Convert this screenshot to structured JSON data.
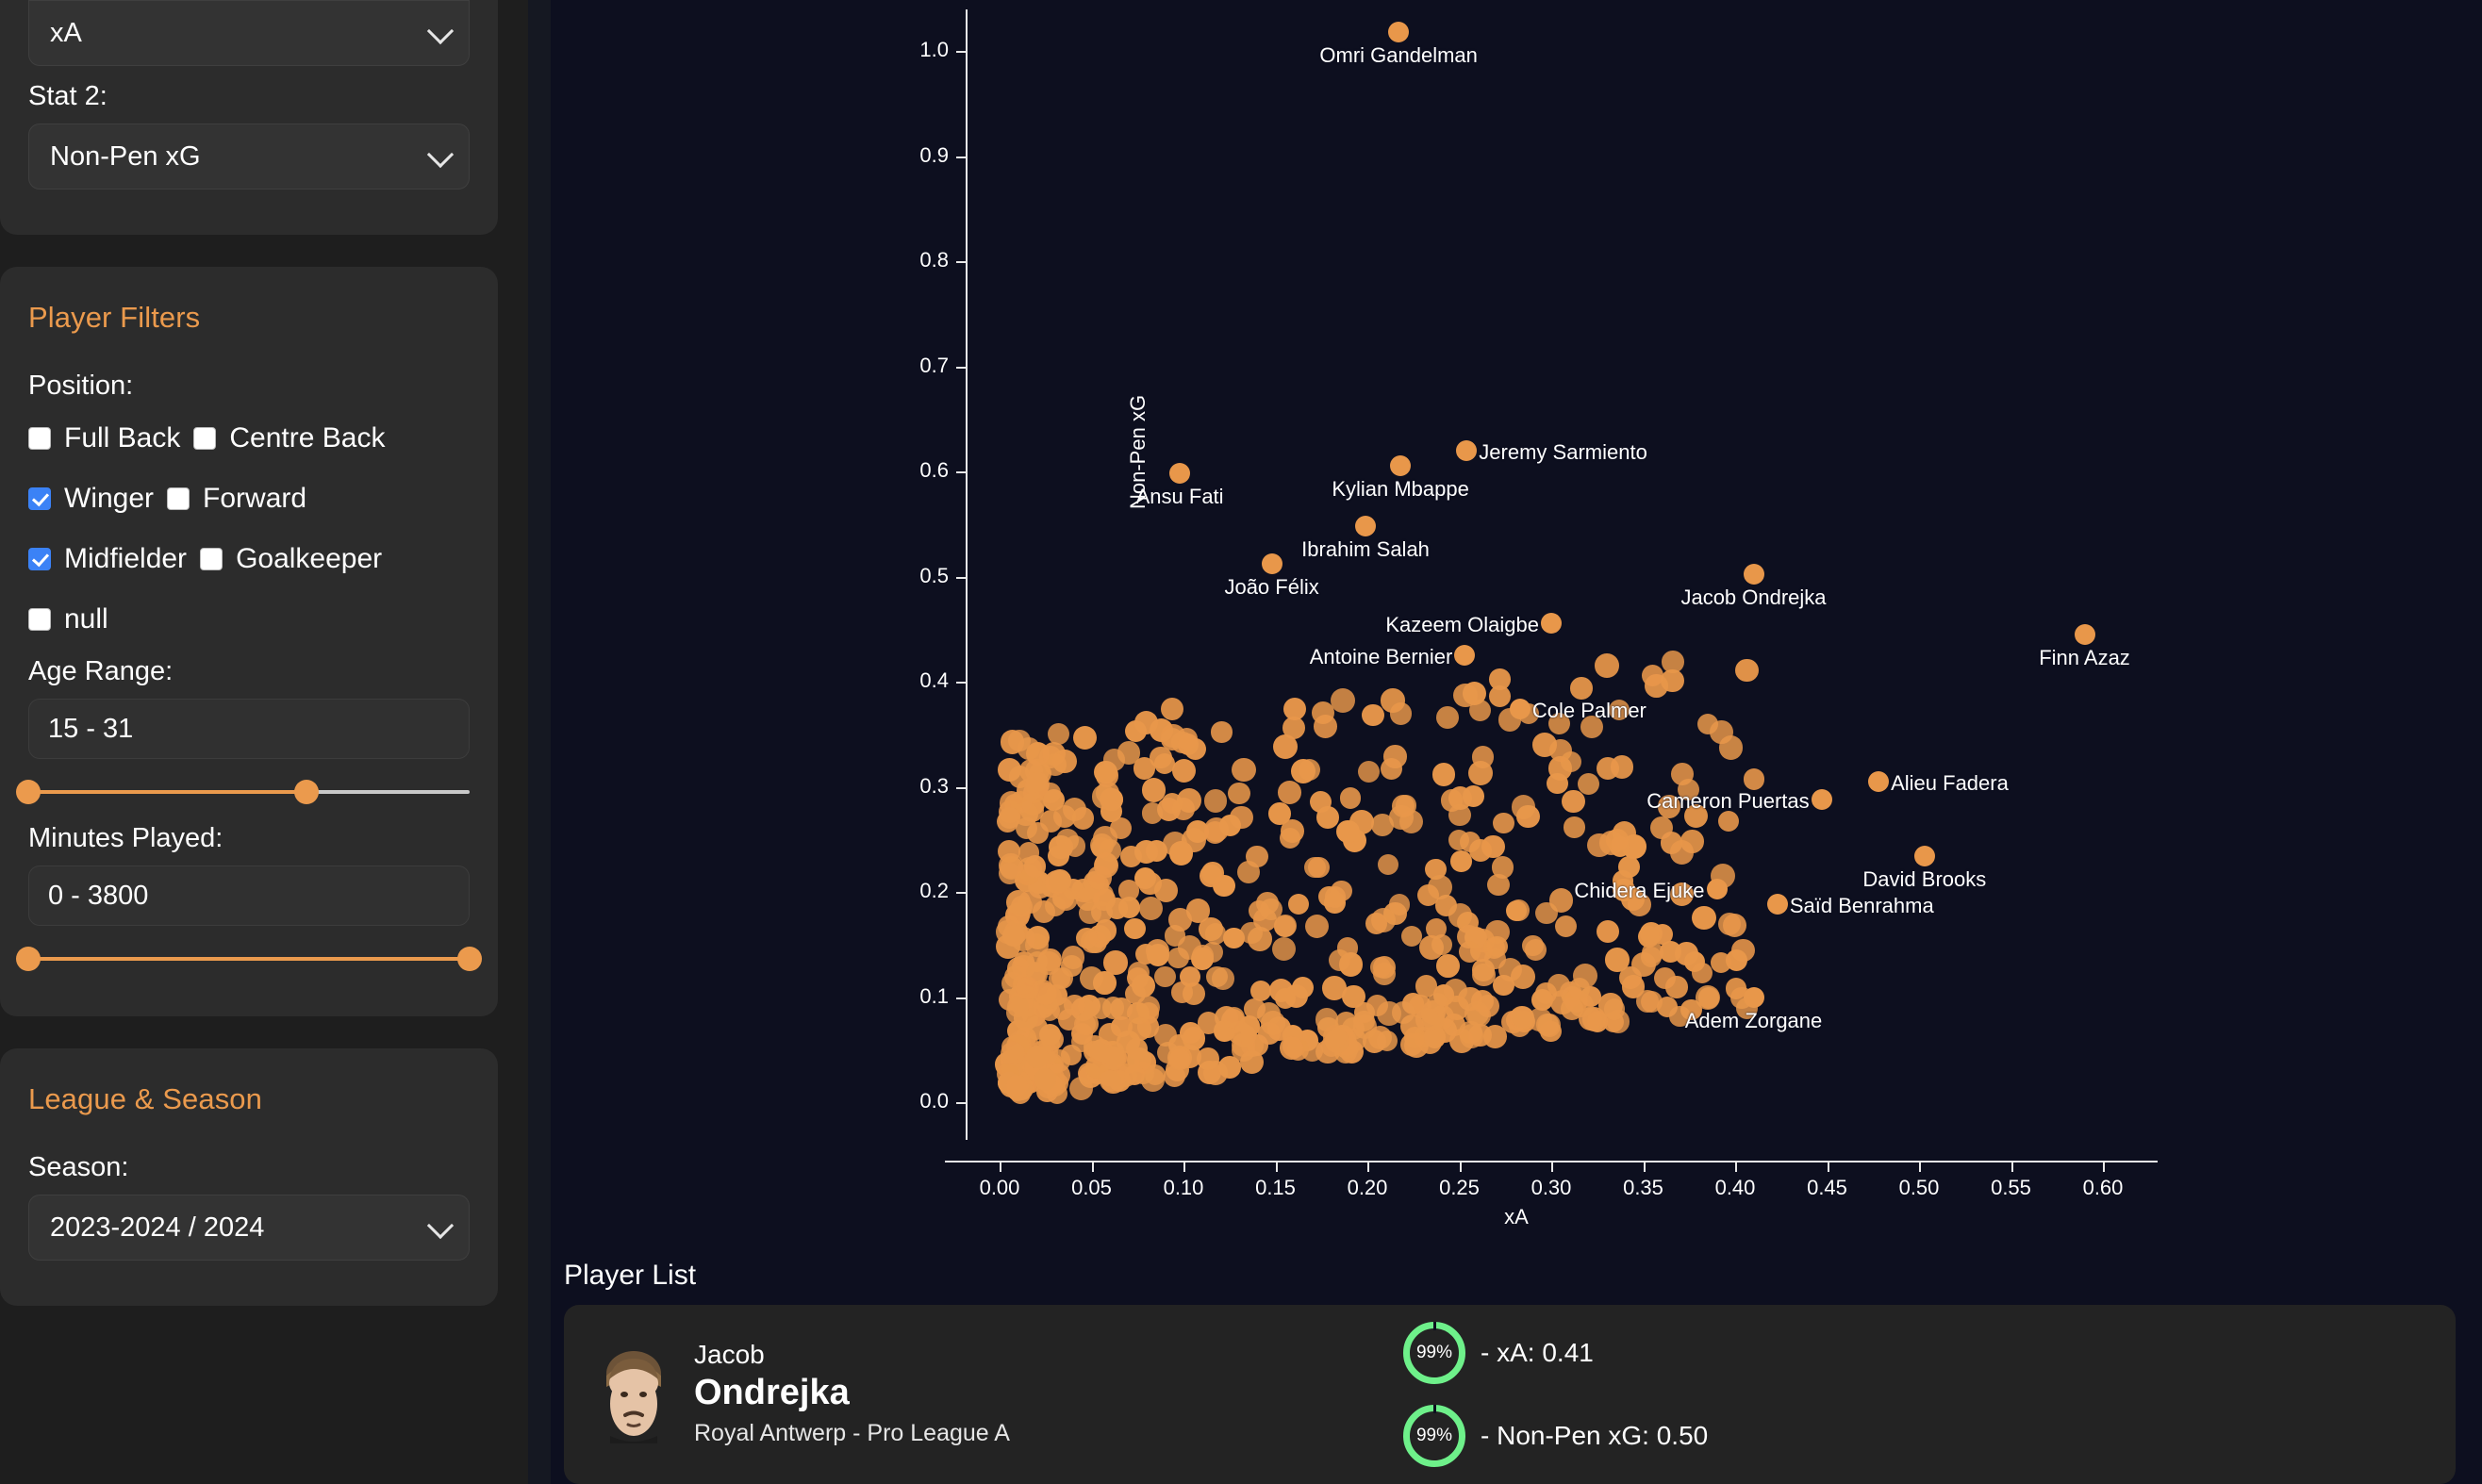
{
  "stat_selectors": {
    "stat1_value": "xA",
    "stat2_label": "Stat 2:",
    "stat2_value": "Non-Pen xG"
  },
  "player_filters": {
    "title": "Player Filters",
    "position_label": "Position:",
    "positions": [
      {
        "label": "Full Back",
        "checked": false
      },
      {
        "label": "Centre Back",
        "checked": false
      },
      {
        "label": "Winger",
        "checked": true
      },
      {
        "label": "Forward",
        "checked": false
      },
      {
        "label": "Midfielder",
        "checked": true
      },
      {
        "label": "Goalkeeper",
        "checked": false
      },
      {
        "label": "null",
        "checked": false
      }
    ],
    "age_label": "Age Range:",
    "age_value": "15 - 31",
    "minutes_label": "Minutes Played:",
    "minutes_value": "0 - 3800"
  },
  "league_season": {
    "title": "League & Season",
    "season_label": "Season:",
    "season_value": "2023-2024 / 2024"
  },
  "player_list": {
    "title": "Player List",
    "rows": [
      {
        "first_name": "Jacob",
        "last_name": "Ondrejka",
        "team": "Royal Antwerp - Pro League A",
        "stats": [
          {
            "pct": "99%",
            "text": "- xA: 0.41"
          },
          {
            "pct": "99%",
            "text": "- Non-Pen xG: 0.50"
          }
        ]
      }
    ]
  },
  "colors": {
    "accent": "#eb9a4d",
    "dot": "#e8974a",
    "checkbox_on": "#3b82f6",
    "ring": "#6ef08a",
    "chart_bg": "#0d0f1f",
    "sidebar_bg": "#1e1e1e",
    "panel_bg": "#2c2c2c"
  },
  "chart_data": {
    "type": "scatter",
    "title": "",
    "xlabel": "xA",
    "ylabel": "Non-Pen xG",
    "xlim": [
      -0.02,
      0.625
    ],
    "ylim": [
      -0.045,
      1.07
    ],
    "xticks": [
      "0.00",
      "0.05",
      "0.10",
      "0.15",
      "0.20",
      "0.25",
      "0.30",
      "0.35",
      "0.40",
      "0.45",
      "0.50",
      "0.55",
      "0.60"
    ],
    "xtick_values": [
      0.0,
      0.05,
      0.1,
      0.15,
      0.2,
      0.25,
      0.3,
      0.35,
      0.4,
      0.45,
      0.5,
      0.55,
      0.6
    ],
    "yticks": [
      "0.0",
      "0.1",
      "0.2",
      "0.3",
      "0.4",
      "0.5",
      "0.6",
      "0.7",
      "0.8",
      "0.9",
      "1.0"
    ],
    "ytick_values": [
      0.0,
      0.1,
      0.2,
      0.3,
      0.4,
      0.5,
      0.6,
      0.7,
      0.8,
      0.9,
      1.0
    ],
    "grid": false,
    "legend": "none",
    "marker_color": "#e8974a",
    "labeled_points": [
      {
        "name": "Omri Gandelman",
        "x": 0.217,
        "y": 1.018
      },
      {
        "name": "Jeremy Sarmiento",
        "x": 0.254,
        "y": 0.62
      },
      {
        "name": "Kylian Mbappe",
        "x": 0.218,
        "y": 0.605
      },
      {
        "name": "Ansu Fati",
        "x": 0.098,
        "y": 0.598
      },
      {
        "name": "Ibrahim Salah",
        "x": 0.199,
        "y": 0.548
      },
      {
        "name": "João Félix",
        "x": 0.148,
        "y": 0.512
      },
      {
        "name": "Jacob Ondrejka",
        "x": 0.41,
        "y": 0.502
      },
      {
        "name": "Kazeem Olaigbe",
        "x": 0.3,
        "y": 0.456
      },
      {
        "name": "Finn Azaz",
        "x": 0.59,
        "y": 0.445
      },
      {
        "name": "Antoine Bernier",
        "x": 0.253,
        "y": 0.425
      },
      {
        "name": "Cole Palmer",
        "x": 0.283,
        "y": 0.374
      },
      {
        "name": "Alieu Fadera",
        "x": 0.478,
        "y": 0.305
      },
      {
        "name": "Cameron Puertas",
        "x": 0.447,
        "y": 0.288
      },
      {
        "name": "David Brooks",
        "x": 0.503,
        "y": 0.234
      },
      {
        "name": "Chidera Ejuke",
        "x": 0.39,
        "y": 0.203
      },
      {
        "name": "Saïd Benrahma",
        "x": 0.423,
        "y": 0.188
      },
      {
        "name": "Adem Zorgane",
        "x": 0.41,
        "y": 0.1
      }
    ],
    "point_count_approx": 640,
    "description": "Dense orange scatter cloud of players concentrated between xA 0.00-0.25 and Non-Pen xG 0.00-0.30, thinning toward upper right."
  }
}
